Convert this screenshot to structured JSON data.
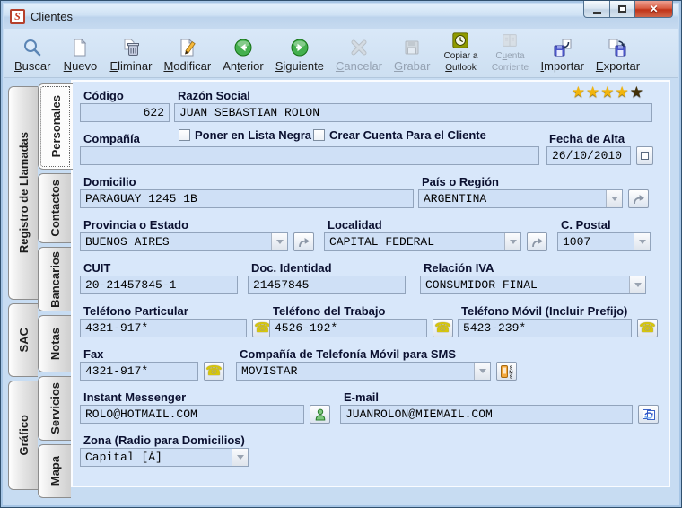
{
  "window": {
    "title": "Clientes",
    "app_icon_letter": "S"
  },
  "toolbar": {
    "items": [
      {
        "label": "Buscar",
        "accel": 0,
        "disabled": false,
        "icon": "search"
      },
      {
        "label": "Nuevo",
        "accel": 0,
        "disabled": false,
        "icon": "new-document"
      },
      {
        "label": "Eliminar",
        "accel": 0,
        "disabled": false,
        "icon": "delete"
      },
      {
        "label": "Modificar",
        "accel": 0,
        "disabled": false,
        "icon": "edit"
      },
      {
        "label": "Anterior",
        "accel": 2,
        "disabled": false,
        "icon": "previous-arrow"
      },
      {
        "label": "Siguiente",
        "accel": 0,
        "disabled": false,
        "icon": "next-arrow"
      },
      {
        "label": "Cancelar",
        "accel": 0,
        "disabled": true,
        "icon": "cancel-x"
      },
      {
        "label": "Grabar",
        "accel": 0,
        "disabled": true,
        "icon": "save-floppy"
      },
      {
        "line1": "Copiar a",
        "line2": "Outlook",
        "accel_line2": 0,
        "disabled": false,
        "icon": "outlook-clock"
      },
      {
        "line1": "Cuenta",
        "line2": "Corriente",
        "accel_line1": 1,
        "disabled": true,
        "icon": "account-ledger"
      },
      {
        "label": "Importar",
        "accel": 0,
        "disabled": false,
        "icon": "import-floppy"
      },
      {
        "label": "Exportar",
        "accel": 0,
        "disabled": false,
        "icon": "export-floppy"
      }
    ]
  },
  "side_tabs": {
    "outer": [
      "Registro de Llamadas",
      "SAC",
      "Gráfico"
    ],
    "inner": [
      "Personales",
      "Contactos",
      "Bancarios",
      "Notas",
      "Servicios",
      "Mapa"
    ],
    "active_tab": "Personales"
  },
  "form": {
    "codigo": {
      "label": "Código",
      "value": "622"
    },
    "razon_social": {
      "label": "Razón Social",
      "value": "JUAN SEBASTIAN ROLON"
    },
    "rating": {
      "filled": 4,
      "total": 5
    },
    "compania": {
      "label": "Compañía",
      "value": ""
    },
    "checkbox_lista_negra": {
      "label": "Poner en Lista Negra",
      "checked": false
    },
    "checkbox_crear_cuenta": {
      "label": "Crear Cuenta Para el Cliente",
      "checked": false
    },
    "fecha_alta": {
      "label": "Fecha de Alta",
      "value": "26/10/2010"
    },
    "domicilio": {
      "label": "Domicilio",
      "value": "PARAGUAY 1245 1B"
    },
    "pais": {
      "label": "País o Región",
      "value": "ARGENTINA"
    },
    "provincia": {
      "label": "Provincia o Estado",
      "value": "BUENOS AIRES"
    },
    "localidad": {
      "label": "Localidad",
      "value": "CAPITAL FEDERAL"
    },
    "cpostal": {
      "label": "C. Postal",
      "value": "1007"
    },
    "cuit": {
      "label": "CUIT",
      "value": "20-21457845-1"
    },
    "doc_identidad": {
      "label": "Doc. Identidad",
      "value": "21457845"
    },
    "relacion_iva": {
      "label": "Relación IVA",
      "value": "CONSUMIDOR FINAL"
    },
    "tel_particular": {
      "label": "Teléfono Particular",
      "value": "4321-917*"
    },
    "tel_trabajo": {
      "label": "Teléfono del Trabajo",
      "value": "4526-192*"
    },
    "tel_movil": {
      "label": "Teléfono Móvil (Incluir Prefijo)",
      "value": "5423-239*"
    },
    "fax": {
      "label": "Fax",
      "value": "4321-917*"
    },
    "cia_sms": {
      "label": "Compañía de Telefonía Móvil para SMS",
      "value": "MOVISTAR"
    },
    "instant_messenger": {
      "label": "Instant Messenger",
      "value": "ROLO@HOTMAIL.COM"
    },
    "email": {
      "label": "E-mail",
      "value": "JUANROLON@MIEMAIL.COM"
    },
    "zona": {
      "label": "Zona (Radio para Domicilios)",
      "value": "Capital [À]"
    }
  },
  "colors": {
    "star_gold": "#f2b50c",
    "star_dark": "#443108",
    "field_bg": "#cfe0f6",
    "label_text": "#0b1030",
    "close_button_red": "#c03318"
  }
}
